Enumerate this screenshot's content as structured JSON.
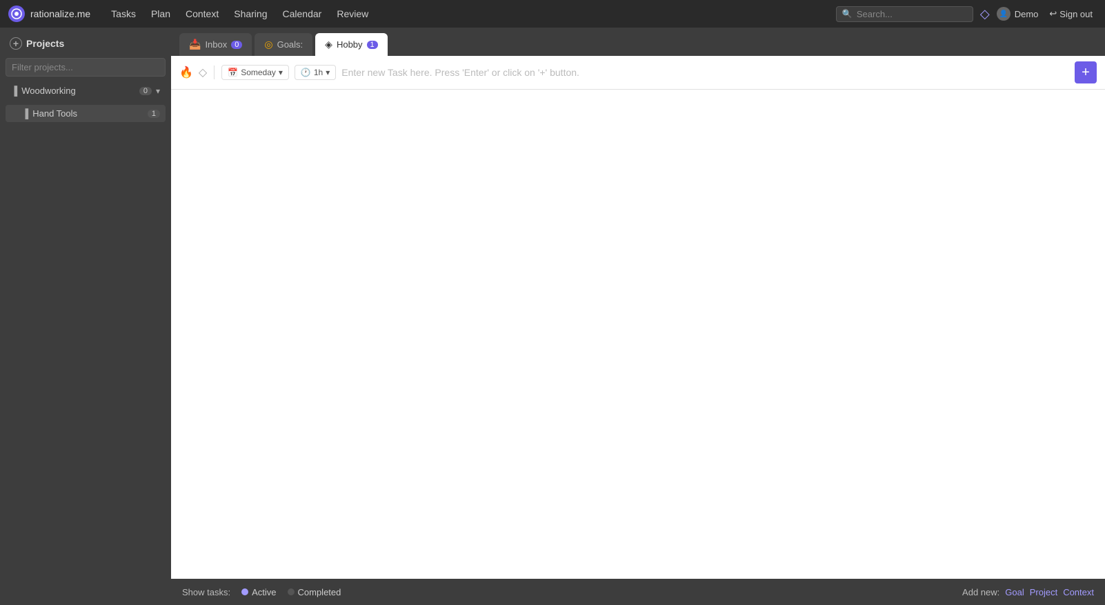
{
  "app": {
    "logo_text": "rationalize.me",
    "logo_symbol": "●"
  },
  "nav": {
    "links": [
      "Tasks",
      "Plan",
      "Context",
      "Sharing",
      "Calendar",
      "Review"
    ]
  },
  "search": {
    "placeholder": "Search..."
  },
  "user": {
    "name": "Demo",
    "signout_label": "Sign out"
  },
  "sidebar": {
    "header_label": "Projects",
    "filter_placeholder": "Filter projects...",
    "projects": [
      {
        "name": "Woodworking",
        "count": "0",
        "expanded": true
      }
    ],
    "subprojects": [
      {
        "name": "Hand Tools",
        "count": "1"
      }
    ]
  },
  "tabs": [
    {
      "id": "inbox",
      "icon": "📥",
      "label": "Inbox",
      "badge": "0",
      "active": false
    },
    {
      "id": "goals",
      "icon": "◎",
      "label": "Goals:",
      "badge": null,
      "active": false
    },
    {
      "id": "hobby",
      "icon": "◈",
      "label": "Hobby",
      "badge": "1",
      "active": true
    }
  ],
  "task_input": {
    "placeholder": "Enter new Task here. Press 'Enter' or click on '+' button.",
    "someday_label": "Someday",
    "time_label": "1h",
    "add_button": "+"
  },
  "bottom_bar": {
    "show_tasks_label": "Show tasks:",
    "active_label": "Active",
    "completed_label": "Completed",
    "add_new_label": "Add new:",
    "add_goal_label": "Goal",
    "add_project_label": "Project",
    "add_context_label": "Context"
  }
}
